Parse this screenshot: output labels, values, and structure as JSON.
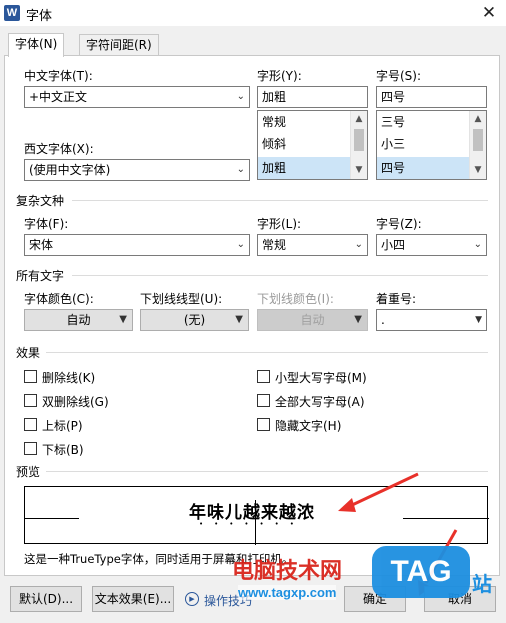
{
  "window": {
    "app_icon": "W",
    "title": "字体",
    "close_glyph": "✕"
  },
  "tabs": [
    {
      "label": "字体(N)"
    },
    {
      "label": "字符间距(R)"
    }
  ],
  "chinese_font": {
    "label": "中文字体(T):",
    "value": "+中文正文"
  },
  "style": {
    "label": "字形(Y):",
    "value": "加粗",
    "options": [
      "常规",
      "倾斜",
      "加粗"
    ],
    "selected_index": 2
  },
  "size": {
    "label": "字号(S):",
    "value": "四号",
    "options": [
      "三号",
      "小三",
      "四号"
    ],
    "selected_index": 2
  },
  "western_font": {
    "label": "西文字体(X):",
    "value": "(使用中文字体)"
  },
  "complex": {
    "section": "复杂文种",
    "font_label": "字体(F):",
    "font_value": "宋体",
    "style_label": "字形(L):",
    "style_value": "常规",
    "size_label": "字号(Z):",
    "size_value": "小四"
  },
  "all_text": {
    "section": "所有文字",
    "color_label": "字体颜色(C):",
    "color_value": "自动",
    "underline_label": "下划线线型(U):",
    "underline_value": "(无)",
    "underline_color_label": "下划线颜色(I):",
    "underline_color_value": "自动",
    "emphasis_label": "着重号:",
    "emphasis_value": "."
  },
  "effects": {
    "section": "效果",
    "left": [
      {
        "label": "删除线(K)",
        "checked": false
      },
      {
        "label": "双删除线(G)",
        "checked": false
      },
      {
        "label": "上标(P)",
        "checked": false
      },
      {
        "label": "下标(B)",
        "checked": false
      }
    ],
    "right": [
      {
        "label": "小型大写字母(M)",
        "checked": false
      },
      {
        "label": "全部大写字母(A)",
        "checked": false
      },
      {
        "label": "隐藏文字(H)",
        "checked": false
      }
    ]
  },
  "preview": {
    "section": "预览",
    "sample_text": "年味儿越来越浓",
    "note": "这是一种TrueType字体，同时适用于屏幕和打印机。"
  },
  "buttons": {
    "default": "默认(D)...",
    "text_effects": "文本效果(E)...",
    "tips": "操作技巧",
    "ok": "确定",
    "cancel": "取消"
  },
  "watermark": {
    "site_name": "电脑技术网",
    "site_url": "www.tagxp.com",
    "logo": "TAG",
    "logo_suffix": "站"
  },
  "colors": {
    "annotation_arrow": "#e8312a",
    "watermark_red": "#d9251c",
    "watermark_blue": "#1d8fe0",
    "selection": "#cce4f7"
  }
}
